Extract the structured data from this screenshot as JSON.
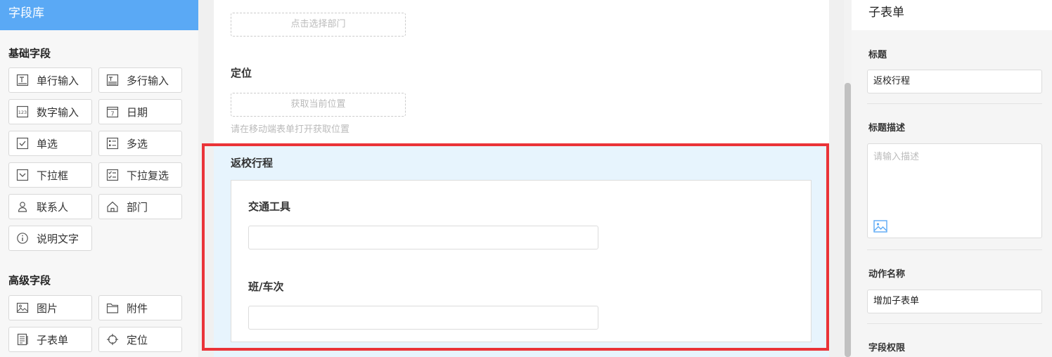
{
  "left": {
    "header": "字段库",
    "basic_title": "基础字段",
    "basic_fields": [
      {
        "label": "单行输入",
        "icon": "single-line-input-icon"
      },
      {
        "label": "多行输入",
        "icon": "multi-line-input-icon"
      },
      {
        "label": "数字输入",
        "icon": "number-input-icon"
      },
      {
        "label": "日期",
        "icon": "date-icon"
      },
      {
        "label": "单选",
        "icon": "single-choice-icon"
      },
      {
        "label": "多选",
        "icon": "multi-choice-icon"
      },
      {
        "label": "下拉框",
        "icon": "dropdown-icon"
      },
      {
        "label": "下拉复选",
        "icon": "dropdown-multi-icon"
      },
      {
        "label": "联系人",
        "icon": "contact-icon"
      },
      {
        "label": "部门",
        "icon": "department-icon"
      },
      {
        "label": "说明文字",
        "icon": "info-icon"
      }
    ],
    "advanced_title": "高级字段",
    "advanced_fields": [
      {
        "label": "图片",
        "icon": "image-icon"
      },
      {
        "label": "附件",
        "icon": "attachment-icon"
      },
      {
        "label": "子表单",
        "icon": "subform-icon"
      },
      {
        "label": "定位",
        "icon": "location-icon"
      }
    ]
  },
  "canvas": {
    "dept_button": "点击选择部门",
    "location_title": "定位",
    "location_button": "获取当前位置",
    "location_hint": "请在移动端表单打开获取位置",
    "subform_title": "返校行程",
    "subform_fields": [
      {
        "label": "交通工具",
        "value": ""
      },
      {
        "label": "班/车次",
        "value": ""
      }
    ]
  },
  "right": {
    "header": "子表单",
    "title_label": "标题",
    "title_value": "返校行程",
    "desc_label": "标题描述",
    "desc_placeholder": "请输入描述",
    "action_label": "动作名称",
    "action_value": "增加子表单",
    "permission_label": "字段权限"
  },
  "colors": {
    "accent": "#5aa9f5",
    "highlight": "#ea3338",
    "selected_bg": "#e7f4fd"
  }
}
